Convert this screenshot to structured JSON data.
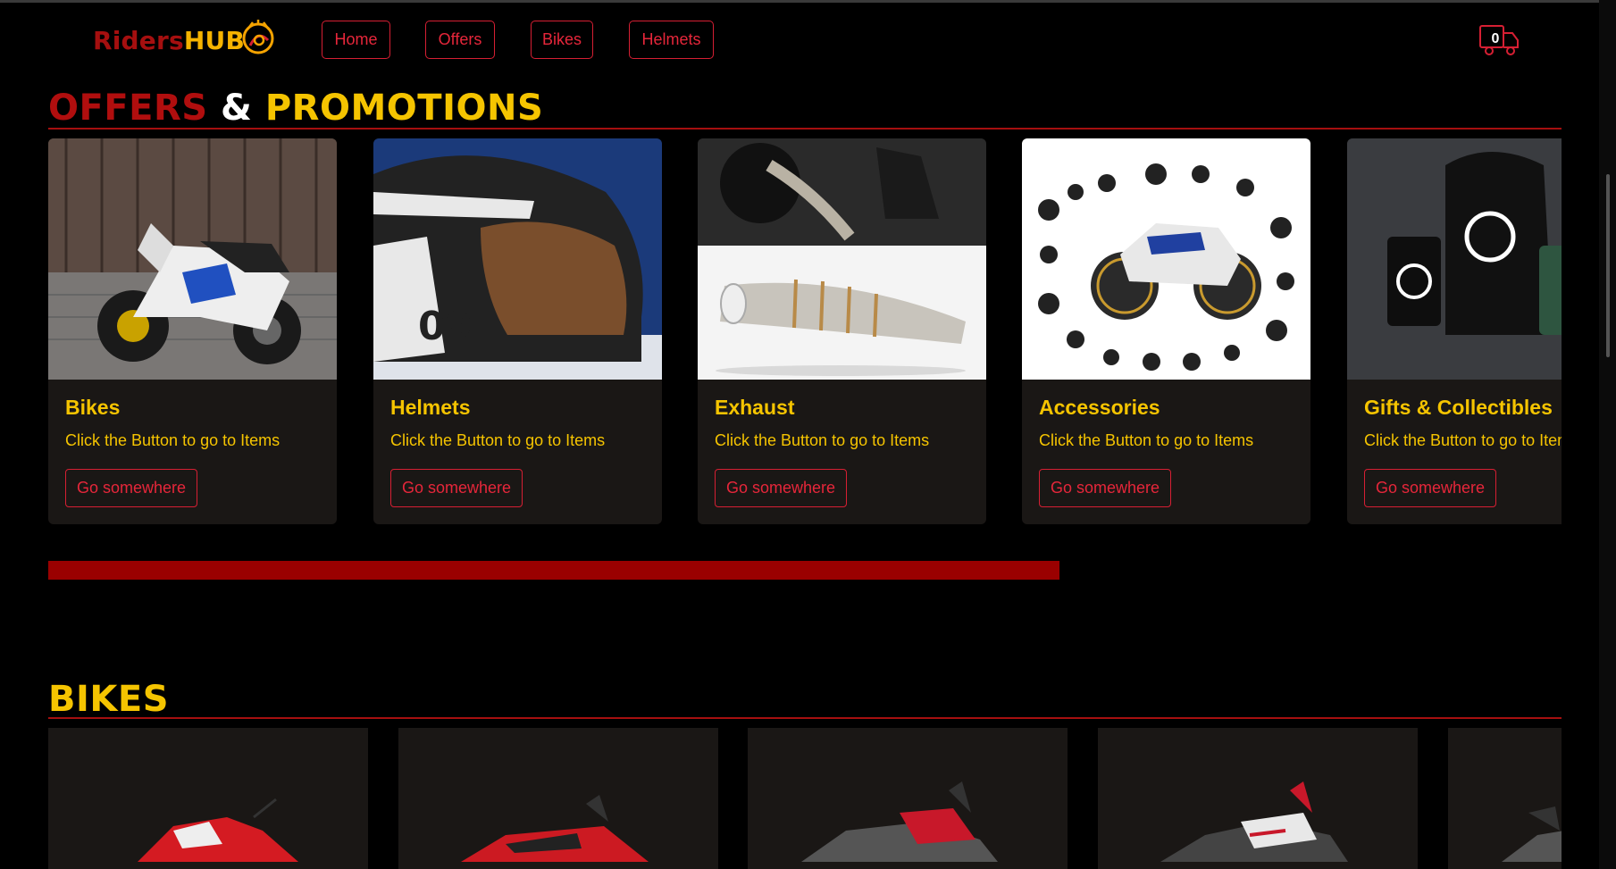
{
  "brand": {
    "part1": "Riders",
    "part2": "HUB",
    "icon": "helmet-logo-icon"
  },
  "nav": {
    "items": [
      {
        "label": "Home"
      },
      {
        "label": "Offers"
      },
      {
        "label": "Bikes"
      },
      {
        "label": "Helmets"
      }
    ],
    "cart": {
      "icon": "cart-icon",
      "count": "0"
    }
  },
  "offers": {
    "heading": {
      "word1": "OFFERS",
      "word2": "&",
      "word3": "PROMOTIONS"
    },
    "cards": [
      {
        "title": "Bikes",
        "text": "Click the Button to go to Items",
        "button": "Go somewhere",
        "image": "white-blue-motorcycle-image"
      },
      {
        "title": "Helmets",
        "text": "Click the Button to go to Items",
        "button": "Go somewhere",
        "image": "black-helmet-image"
      },
      {
        "title": "Exhaust",
        "text": "Click the Button to go to Items",
        "button": "Go somewhere",
        "image": "chrome-exhaust-image"
      },
      {
        "title": "Accessories",
        "text": "Click the Button to go to Items",
        "button": "Go somewhere",
        "image": "bike-accessories-image"
      },
      {
        "title": "Gifts & Collectibles",
        "text": "Click the Button to go to Items",
        "button": "Go somewhere",
        "image": "kawasaki-merch-image"
      }
    ],
    "scroll_progress": 0.668
  },
  "bikes": {
    "heading": "BIKES",
    "images": [
      "red-sportbike-image",
      "red-supermoto-image",
      "red-adventure-bike-image",
      "ducati-desertx-image",
      "adventure-bike-partial-image"
    ]
  },
  "colors": {
    "brand_red": "#a50f0f",
    "accent_yellow": "#f5c400",
    "button_red": "#e6263a",
    "card_bg": "#1a1715",
    "progress_red": "#9a0000"
  }
}
